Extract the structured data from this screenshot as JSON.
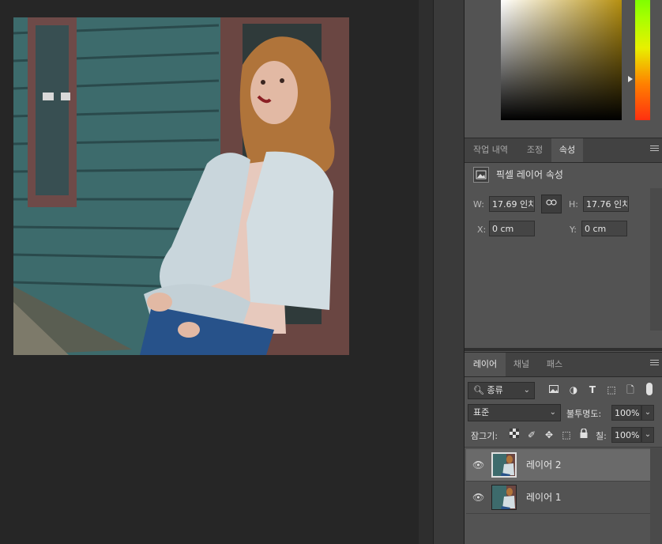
{
  "properties_panel": {
    "tabs": [
      {
        "label": "작업 내역",
        "active": false
      },
      {
        "label": "조정",
        "active": false
      },
      {
        "label": "속성",
        "active": true
      }
    ],
    "section_title": "픽셀 레이어 속성",
    "width_label": "W:",
    "width_value": "17.69 인치",
    "height_label": "H:",
    "height_value": "17.76 인치",
    "x_label": "X:",
    "x_value": "0 cm",
    "y_label": "Y:",
    "y_value": "0 cm"
  },
  "layers_panel": {
    "tabs": [
      {
        "label": "레이어",
        "active": true
      },
      {
        "label": "채널",
        "active": false
      },
      {
        "label": "패스",
        "active": false
      }
    ],
    "filter_kind": "종류",
    "blend_mode": "표준",
    "opacity_label": "불투명도:",
    "opacity_value": "100%",
    "lock_label": "잠그기:",
    "fill_label": "칠:",
    "fill_value": "100%",
    "layers": [
      {
        "name": "레이어 2",
        "selected": true,
        "visible": true
      },
      {
        "name": "레이어 1",
        "selected": false,
        "visible": true
      }
    ]
  },
  "colors": {
    "picker_hue": "#b58f10",
    "panel_bg": "#535353"
  }
}
